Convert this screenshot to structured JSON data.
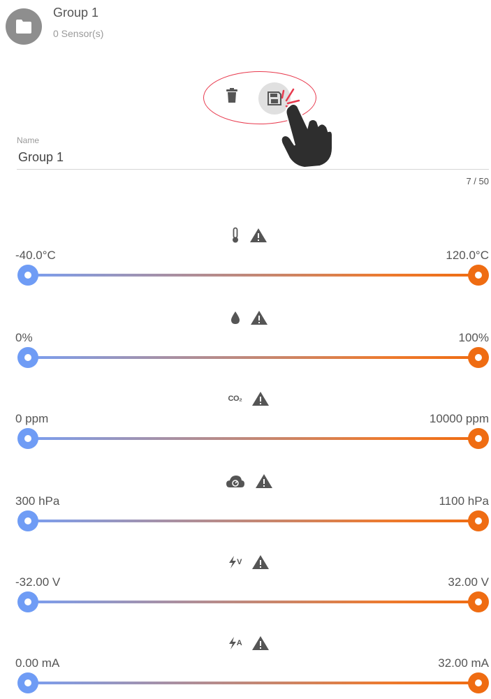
{
  "header": {
    "title": "Group 1",
    "subtitle": "0 Sensor(s)",
    "avatar_icon": "folder-icon"
  },
  "actions": {
    "delete_icon": "trash-icon",
    "save_icon": "save-icon",
    "highlight_color": "#e8394d"
  },
  "name_field": {
    "label": "Name",
    "value": "Group 1",
    "counter": "7 / 50"
  },
  "colors": {
    "min_thumb": "#6f9cf5",
    "max_thumb": "#ef6c12",
    "icon": "#555555"
  },
  "sensors": [
    {
      "icon": "thermometer-icon",
      "alert_icon": "warning-icon",
      "min": "-40.0°C",
      "max": "120.0°C"
    },
    {
      "icon": "humidity-drop-icon",
      "alert_icon": "warning-icon",
      "min": "0%",
      "max": "100%"
    },
    {
      "icon": "co2-icon",
      "icon_text": "CO₂",
      "alert_icon": "warning-icon",
      "min": "0 ppm",
      "max": "10000 ppm"
    },
    {
      "icon": "pressure-cloud-icon",
      "alert_icon": "warning-icon",
      "min": "300 hPa",
      "max": "1100 hPa"
    },
    {
      "icon": "voltage-icon",
      "icon_text": "V",
      "alert_icon": "warning-icon",
      "min": "-32.00 V",
      "max": "32.00 V"
    },
    {
      "icon": "current-icon",
      "icon_text": "A",
      "alert_icon": "warning-icon",
      "min": "0.00 mA",
      "max": "32.00 mA"
    }
  ]
}
